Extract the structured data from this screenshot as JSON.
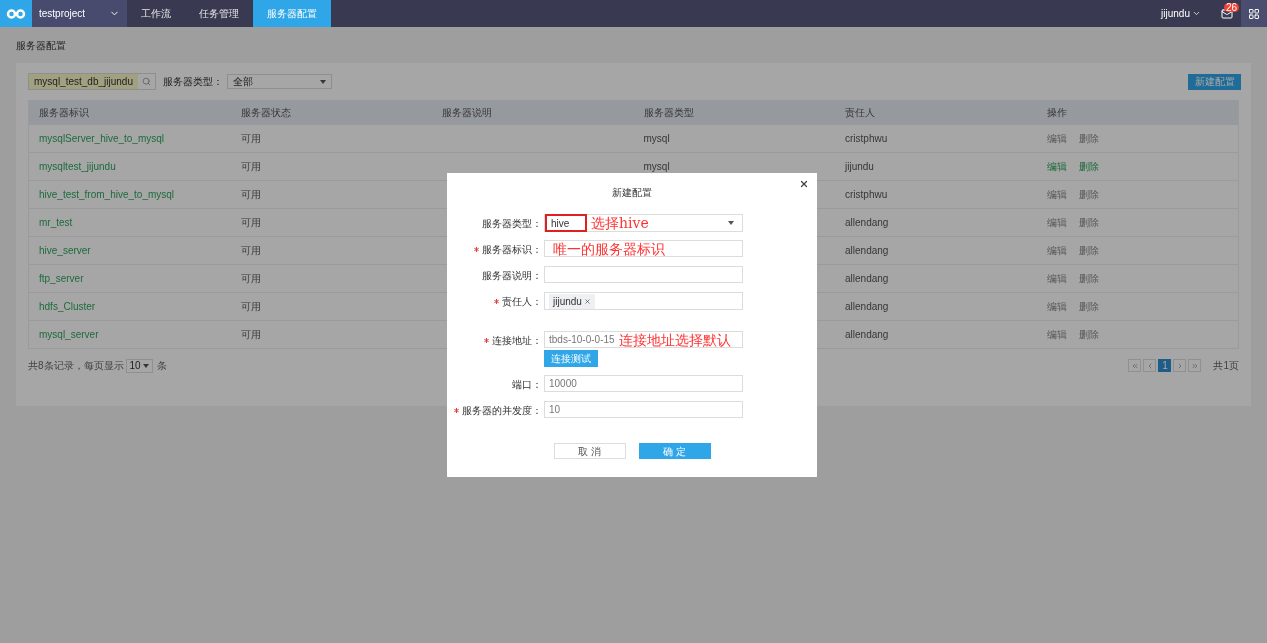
{
  "nav": {
    "project": "testproject",
    "tabs": [
      {
        "label": "工作流",
        "selected": false
      },
      {
        "label": "任务管理",
        "selected": false
      },
      {
        "label": "服务器配置",
        "selected": true
      }
    ],
    "user": "jijundu",
    "notifications": "26"
  },
  "page_title": "服务器配置",
  "toolbar": {
    "search_value": "mysql_test_db_jijundu",
    "filter_label": "服务器类型：",
    "filter_value": "全部",
    "new_button": "新建配置"
  },
  "table": {
    "columns": [
      "服务器标识",
      "服务器状态",
      "服务器说明",
      "服务器类型",
      "责任人",
      "操作"
    ],
    "rows": [
      {
        "id": "mysqlServer_hive_to_mysql",
        "status": "可用",
        "type": "mysql",
        "owner": "cristphwu",
        "actions": [
          "编辑",
          "删除"
        ],
        "hovered": false
      },
      {
        "id": "mysqltest_jijundu",
        "status": "可用",
        "type": "mysql",
        "owner": "jijundu",
        "actions": [
          "编辑",
          "删除"
        ],
        "hovered": true
      },
      {
        "id": "hive_test_from_hive_to_mysql",
        "status": "可用",
        "owner": "cristphwu",
        "actions": [
          "编辑",
          "删除"
        ],
        "hovered": false
      },
      {
        "id": "mr_test",
        "status": "可用",
        "owner": "allendang",
        "actions": [
          "编辑",
          "删除"
        ],
        "hovered": false
      },
      {
        "id": "hive_server",
        "status": "可用",
        "owner": "allendang",
        "actions": [
          "编辑",
          "删除"
        ],
        "hovered": false
      },
      {
        "id": "ftp_server",
        "status": "可用",
        "owner": "allendang",
        "actions": [
          "编辑",
          "删除"
        ],
        "hovered": false
      },
      {
        "id": "hdfs_Cluster",
        "status": "可用",
        "owner": "allendang",
        "actions": [
          "编辑",
          "删除"
        ],
        "hovered": false
      },
      {
        "id": "mysql_server",
        "status": "可用",
        "owner": "allendang",
        "actions": [
          "编辑",
          "删除"
        ],
        "hovered": false
      }
    ]
  },
  "footer": {
    "summary": "共8条记录，每页显示",
    "page_size": "10",
    "unit": "条",
    "pages": [
      {
        "label": "1",
        "selected": true
      }
    ],
    "total": "共1页"
  },
  "dialog": {
    "title": "新建配置",
    "fields": [
      {
        "label": "服务器类型：",
        "required": false,
        "kind": "select",
        "value": "hive",
        "annotation": "选择hive",
        "boxed": true
      },
      {
        "label": "服务器标识：",
        "required": true,
        "kind": "text",
        "annotation": "唯一的服务器标识"
      },
      {
        "label": "服务器说明：",
        "required": false,
        "kind": "text"
      },
      {
        "label": "责任人：",
        "required": true,
        "kind": "tags",
        "tags": [
          "jijundu"
        ]
      },
      {
        "label": "连接地址：",
        "required": true,
        "kind": "text",
        "value": "tbds-10-0-0-15",
        "annotation": "连接地址选择默认",
        "button": "连接测试"
      },
      {
        "label": "端口：",
        "required": false,
        "kind": "text",
        "value": "10000"
      },
      {
        "label": "服务器的并发度：",
        "required": true,
        "kind": "text",
        "value": "10"
      }
    ],
    "cancel": "取 消",
    "ok": "确 定"
  }
}
